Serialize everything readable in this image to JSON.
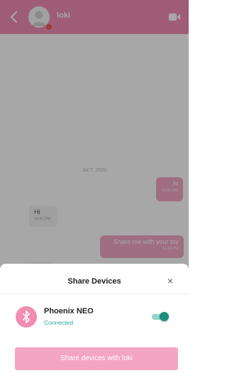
{
  "header": {
    "contact_name": "loki",
    "back_icon": "chevron-left-icon",
    "video_icon": "video-camera-icon",
    "online_status_color": "#e22b2b",
    "bar_color": "#ee6a9a"
  },
  "chat": {
    "date_separator": "Jul 7, 2020",
    "messages": [
      {
        "direction": "outgoing",
        "text": "hi",
        "time": "11:40 PM"
      },
      {
        "direction": "incoming",
        "text": "Hi",
        "time": "11:41 PM"
      },
      {
        "direction": "outgoing",
        "text": "Share me with your toy",
        "time": "11:42 PM"
      },
      {
        "direction": "incoming",
        "text": "",
        "time": ""
      }
    ]
  },
  "sheet": {
    "title": "Share Devices",
    "close_label": "×",
    "device": {
      "name": "Phoenix NEO",
      "status": "Connected",
      "icon": "bluetooth-icon",
      "shared": true
    },
    "share_button_label": "Share devices with loki"
  },
  "colors": {
    "accent": "#ee6a9a",
    "connected": "#2aa89a",
    "toggle_on": "#1f8c7f"
  }
}
